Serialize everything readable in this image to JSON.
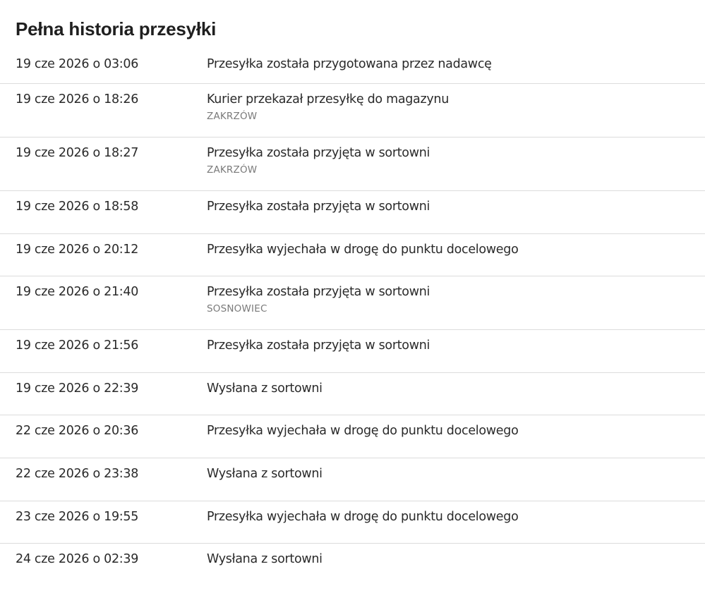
{
  "header": {
    "title": "Pełna historia przesyłki"
  },
  "events": [
    {
      "date": "19 cze 2026 o 03:06",
      "description": "Przesyłka została przygotowana przez nadawcę",
      "location": ""
    },
    {
      "date": "19 cze 2026 o 18:26",
      "description": "Kurier przekazał przesyłkę do magazynu",
      "location": "ZAKRZÓW"
    },
    {
      "date": "19 cze 2026 o 18:27",
      "description": "Przesyłka została przyjęta w sortowni",
      "location": "ZAKRZÓW"
    },
    {
      "date": "19 cze 2026 o 18:58",
      "description": "Przesyłka została przyjęta w sortowni",
      "location": ""
    },
    {
      "date": "19 cze 2026 o 20:12",
      "description": "Przesyłka wyjechała w drogę do punktu docelowego",
      "location": ""
    },
    {
      "date": "19 cze 2026 o 21:40",
      "description": "Przesyłka została przyjęta w sortowni",
      "location": "SOSNOWIEC"
    },
    {
      "date": "19 cze 2026 o 21:56",
      "description": "Przesyłka została przyjęta w sortowni",
      "location": ""
    },
    {
      "date": "19 cze 2026 o 22:39",
      "description": "Wysłana z sortowni",
      "location": ""
    },
    {
      "date": "22 cze 2026 o 20:36",
      "description": "Przesyłka wyjechała w drogę do punktu docelowego",
      "location": ""
    },
    {
      "date": "22 cze 2026 o 23:38",
      "description": "Wysłana z sortowni",
      "location": ""
    },
    {
      "date": "23 cze 2026 o 19:55",
      "description": "Przesyłka wyjechała w drogę do punktu docelowego",
      "location": ""
    },
    {
      "date": "24 cze 2026 o 02:39",
      "description": "Wysłana z sortowni",
      "location": ""
    }
  ]
}
